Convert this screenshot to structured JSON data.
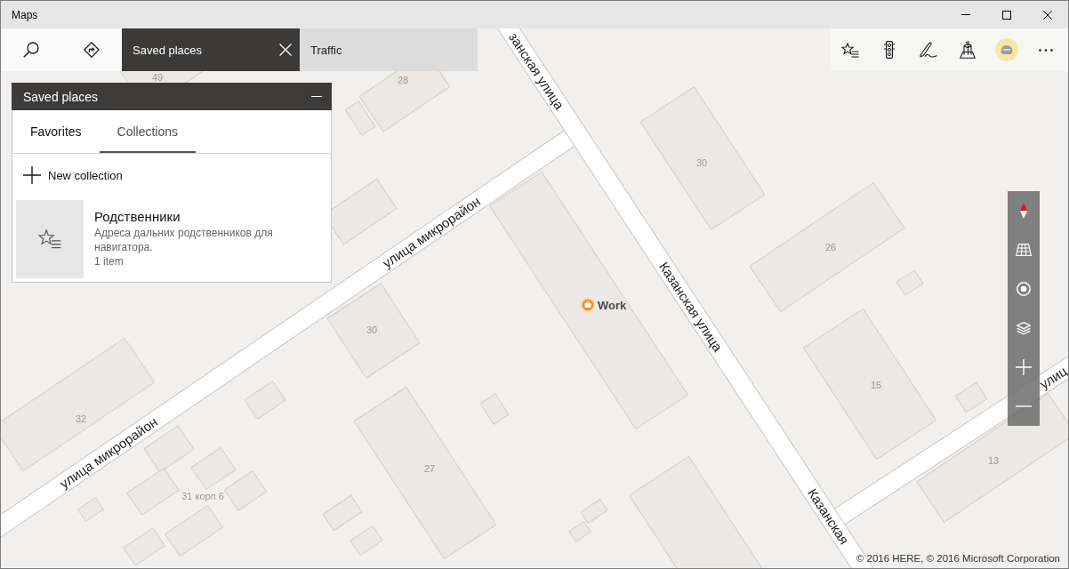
{
  "window": {
    "title": "Maps"
  },
  "toolbar": {
    "tabs": [
      {
        "label": "Saved places",
        "selected": true
      },
      {
        "label": "Traffic",
        "selected": false
      }
    ]
  },
  "saved_places": {
    "title": "Saved places",
    "tabs": [
      {
        "label": "Favorites",
        "selected": false
      },
      {
        "label": "Collections",
        "selected": true
      }
    ],
    "new_collection": "New collection",
    "collections": [
      {
        "name": "Родственники",
        "description": "Адреса дальних родственников для навигатора.",
        "count": "1 item"
      }
    ]
  },
  "map": {
    "building_numbers": [
      "49",
      "28",
      "30",
      "26",
      "15",
      "13",
      "30",
      "32",
      "27",
      "31 корп 6"
    ],
    "street_names": [
      "занская улица",
      "Казанская улица",
      "Казанская",
      "улица микрорайон",
      "улица микрорайон",
      "улиц"
    ],
    "pins": [
      {
        "label": "Work"
      }
    ],
    "copyright": "© 2016 HERE, © 2016 Microsoft Corporation"
  }
}
